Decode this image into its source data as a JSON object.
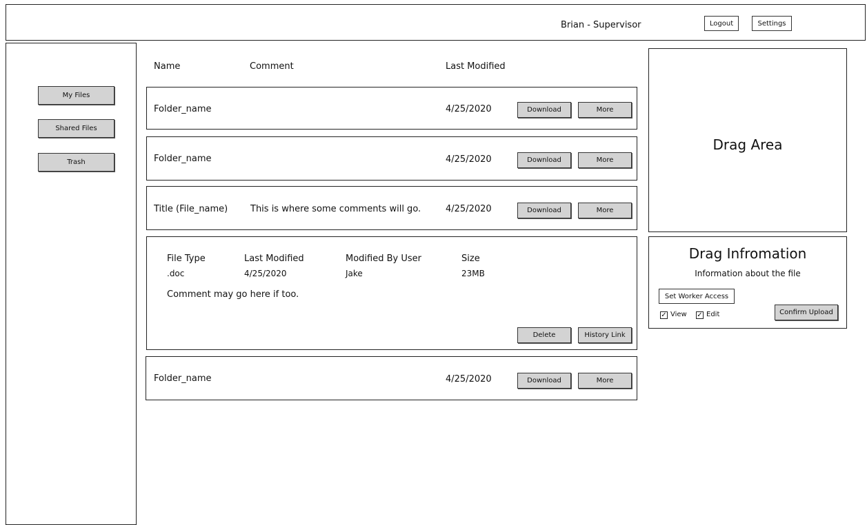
{
  "header": {
    "user_label": "Brian - Supervisor",
    "logout_label": "Logout",
    "settings_label": "Settings"
  },
  "sidebar": {
    "items": [
      {
        "label": "My Files"
      },
      {
        "label": "Shared Files"
      },
      {
        "label": "Trash"
      }
    ]
  },
  "file_list": {
    "columns": {
      "name": "Name",
      "comment": "Comment",
      "last_modified": "Last Modified"
    },
    "rows": [
      {
        "name": "Folder_name",
        "comment": "",
        "date": "4/25/2020",
        "download": "Download",
        "more": "More"
      },
      {
        "name": "Folder_name",
        "comment": "",
        "date": "4/25/2020",
        "download": "Download",
        "more": "More"
      },
      {
        "name": "Title (File_name)",
        "comment": "This is where some comments will go.",
        "date": "4/25/2020",
        "download": "Download",
        "more": "More"
      },
      {
        "name": "Folder_name",
        "comment": "",
        "date": "4/25/2020",
        "download": "Download",
        "more": "More"
      }
    ],
    "details": {
      "headers": {
        "file_type": "File Type",
        "last_modified": "Last Modified",
        "modified_by": "Modified By User",
        "size": "Size"
      },
      "values": {
        "file_type": ".doc",
        "last_modified": "4/25/2020",
        "modified_by": "Jake",
        "size": "23MB"
      },
      "comment": "Comment may go here if too.",
      "delete_label": "Delete",
      "history_label": "History Link"
    }
  },
  "drag_area": {
    "title": "Drag Area"
  },
  "drag_info": {
    "title": "Drag Infromation",
    "subtitle": "Information about the file",
    "worker_access_label": "Set Worker Access",
    "view_label": "View",
    "edit_label": "Edit",
    "view_checked": true,
    "edit_checked": true,
    "confirm_label": "Confirm Upload"
  }
}
